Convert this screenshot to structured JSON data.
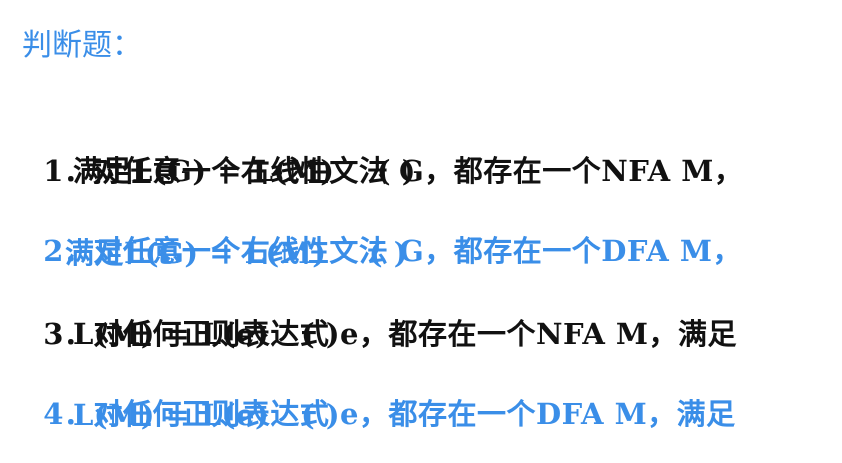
{
  "title": "判断题：",
  "colors": {
    "accent": "#3a8ee8",
    "text": "#111111"
  },
  "questions": [
    {
      "number": "1．",
      "line1": "对任意一个右线性文法 G，都存在一个NFA M，",
      "line2": "满足L(G) = L(M)    ( )",
      "color": "black"
    },
    {
      "number": "2．",
      "line1": "对任意一个右线性文法 G，都存在一个DFA M，",
      "line2": "满足L(G) = L(M)    ( )",
      "color": "blue"
    },
    {
      "number": "3．",
      "line1": "对任何正则表达式 e，都存在一个NFA M，满足",
      "line2": "L(M) = L(e)   ( )",
      "color": "black"
    },
    {
      "number": "4．",
      "line1": "对任何正则表达式 e，都存在一个DFA M，满足",
      "line2": "L(M) = L(e)   ( )",
      "color": "blue"
    }
  ]
}
